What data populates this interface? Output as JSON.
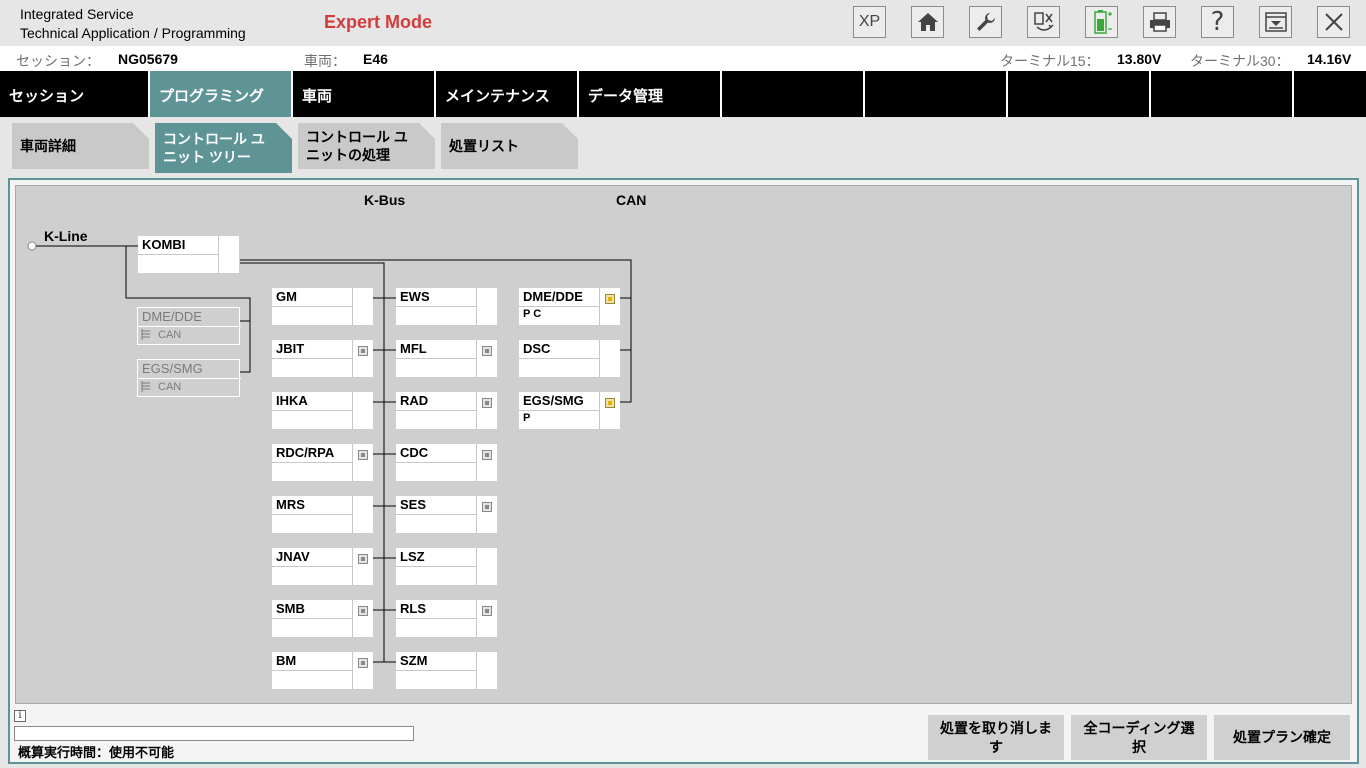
{
  "app": {
    "title_line1": "Integrated Service",
    "title_line2": "Technical Application / Programming",
    "mode": "Expert Mode"
  },
  "toolbar": {
    "xp_label": "XP",
    "help_label": "?",
    "icons": [
      "xp-icon",
      "home-icon",
      "wrench-icon",
      "swap-icon",
      "battery-icon",
      "printer-icon",
      "help-icon",
      "minimize-icon",
      "close-icon"
    ],
    "battery_color": "#3aa83a"
  },
  "info": {
    "session_label": "セッション：",
    "session_value": "NG05679",
    "vehicle_label": "車両：",
    "vehicle_value": "E46",
    "t15_label": "ターミナル15：",
    "t15_value": "13.80V",
    "t30_label": "ターミナル30：",
    "t30_value": "14.16V"
  },
  "nav": {
    "tabs": [
      {
        "label": "セッション"
      },
      {
        "label": "プログラミング"
      },
      {
        "label": "車両"
      },
      {
        "label": "メインテナンス"
      },
      {
        "label": "データ管理"
      }
    ]
  },
  "subtabs": [
    {
      "label": "車両詳細"
    },
    {
      "label_line1": "コントロール ユ",
      "label_line2": "ニット ツリー"
    },
    {
      "label_line1": "コントロール ユ",
      "label_line2": "ニットの処理"
    },
    {
      "label": "処置リスト"
    }
  ],
  "diagram": {
    "kbus_label": "K-Bus",
    "can_label": "CAN",
    "kline_label": "K-Line",
    "kombi": {
      "name": "KOMBI"
    },
    "ghost": [
      {
        "name": "DME/DDE",
        "sub": "CAN"
      },
      {
        "name": "EGS/SMG",
        "sub": "CAN"
      }
    ],
    "col1": [
      {
        "name": "GM",
        "indicator": false
      },
      {
        "name": "JBIT",
        "indicator": true
      },
      {
        "name": "IHKA",
        "indicator": false
      },
      {
        "name": "RDC/RPA",
        "indicator": true
      },
      {
        "name": "MRS",
        "indicator": false
      },
      {
        "name": "JNAV",
        "indicator": true
      },
      {
        "name": "SMB",
        "indicator": true
      },
      {
        "name": "BM",
        "indicator": true
      }
    ],
    "col2": [
      {
        "name": "EWS",
        "indicator": false
      },
      {
        "name": "MFL",
        "indicator": true
      },
      {
        "name": "RAD",
        "indicator": true
      },
      {
        "name": "CDC",
        "indicator": true
      },
      {
        "name": "SES",
        "indicator": true
      },
      {
        "name": "LSZ",
        "indicator": false
      },
      {
        "name": "RLS",
        "indicator": true
      },
      {
        "name": "SZM",
        "indicator": false
      }
    ],
    "can": [
      {
        "name": "DME/DDE",
        "sub": "P C",
        "indicator": "warn"
      },
      {
        "name": "DSC",
        "sub": "",
        "indicator": "none"
      },
      {
        "name": "EGS/SMG",
        "sub": "P",
        "indicator": "warn"
      }
    ]
  },
  "footer": {
    "info_glyph": "i",
    "estimate_label": "概算実行時間：使用不可能",
    "cancel_line1": "処置を取り消しま",
    "cancel_line2": "す",
    "coding_line1": "全コーディング選",
    "coding_line2": "択",
    "confirm_label": "処置プラン確定"
  }
}
